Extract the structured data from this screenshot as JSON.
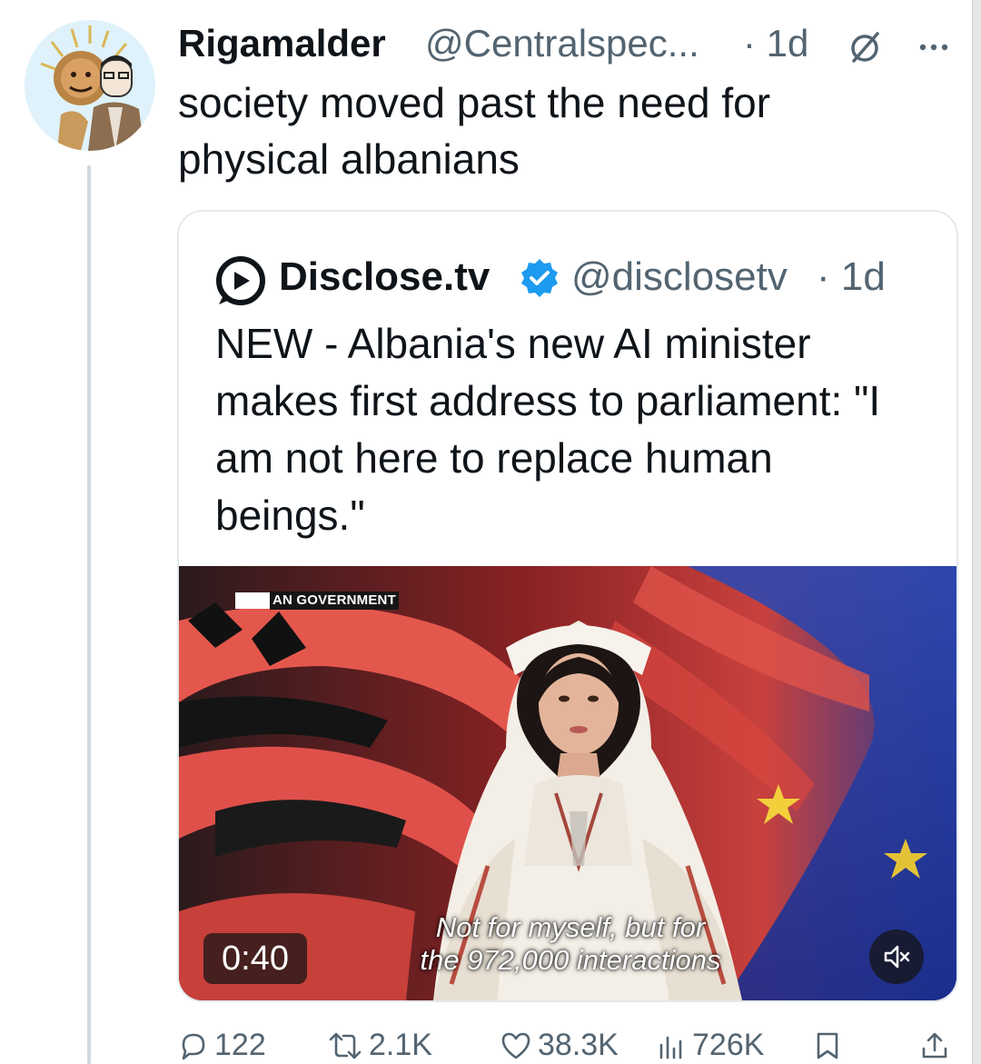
{
  "tweet": {
    "author_name": "Rigamalder",
    "author_handle": "@Centralspec...",
    "time": "· 1d",
    "text": "society moved past the need for physical albanians"
  },
  "quoted": {
    "author_name": "Disclose.tv",
    "author_handle": "@disclosetv",
    "time": "· 1d",
    "text": "NEW - Albania's new AI minister makes first address to parliament: \"I am not here to replace human beings.\"",
    "video": {
      "channel_tag": "AN GOVERNMENT",
      "subtitle_line1": "Not for myself, but for",
      "subtitle_line2": "the 972,000 interactions",
      "duration": "0:40",
      "muted": true
    }
  },
  "actions": {
    "replies": "122",
    "reposts": "2.1K",
    "likes": "38.3K",
    "views": "726K"
  },
  "colors": {
    "text": "#0f1419",
    "secondary": "#536471",
    "verified": "#1d9bf0",
    "border": "#e4e9ec",
    "thread_line": "#cfd9de"
  },
  "icons": [
    "grok-icon",
    "more-icon",
    "disclose-logo-icon",
    "verified-icon",
    "mute-icon",
    "reply-icon",
    "repost-icon",
    "like-icon",
    "views-icon",
    "bookmark-icon",
    "share-icon"
  ]
}
